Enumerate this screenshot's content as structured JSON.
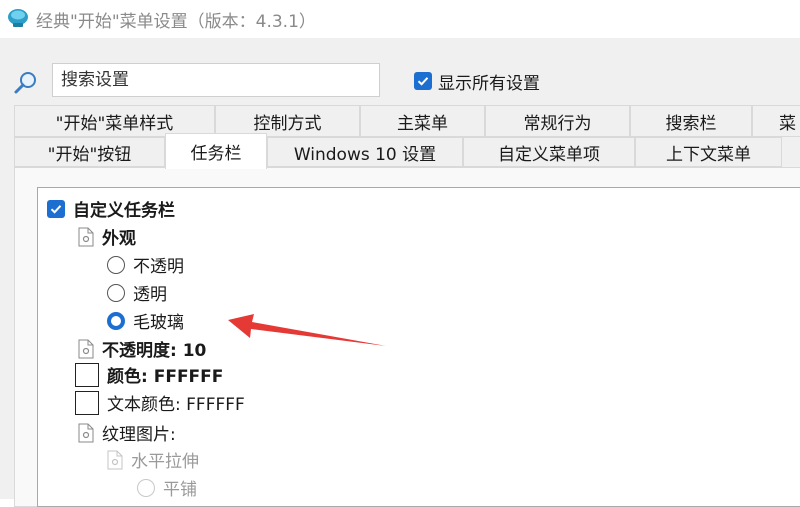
{
  "window": {
    "title": "经典\"开始\"菜单设置（版本：4.3.1）"
  },
  "search": {
    "placeholder": "搜索设置"
  },
  "show_all": {
    "label": "显示所有设置",
    "checked": true
  },
  "tabs_row1": [
    "\"开始\"菜单样式",
    "控制方式",
    "主菜单",
    "常规行为",
    "搜索栏",
    "菜"
  ],
  "tabs_row2": [
    "\"开始\"按钮",
    "任务栏",
    "Windows 10 设置",
    "自定义菜单项",
    "上下文菜单"
  ],
  "active_tab": "任务栏",
  "tree": {
    "customize_taskbar": "自定义任务栏",
    "appearance": "外观",
    "options": [
      "不透明",
      "透明",
      "毛玻璃"
    ],
    "selected_option": "毛玻璃",
    "opacity": "不透明度: 10",
    "color": "颜色: FFFFFF",
    "text_color": "文本颜色: FFFFFF",
    "texture": "纹理图片:",
    "stretch_horizontal": "水平拉伸",
    "tile": "平铺"
  },
  "colors": {
    "accent": "#1c6fd1",
    "annotation_arrow": "#e53935"
  }
}
